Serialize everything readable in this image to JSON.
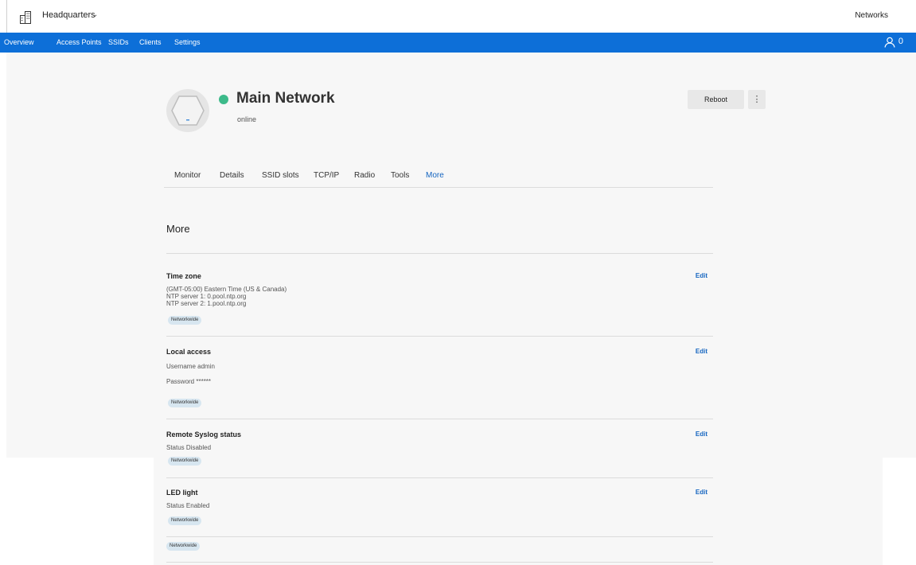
{
  "header": {
    "site_name": "Headquarters",
    "site_chevron": "⌄",
    "networks_label": "Networks",
    "building_icon": "building-icon"
  },
  "nav": {
    "items": [
      "Overview",
      "Access Points",
      "SSIDs",
      "Clients",
      "Settings"
    ],
    "user_count": "0",
    "color": "#0d6fd8"
  },
  "device": {
    "title": "Main Network",
    "status": "online",
    "status_color": "#3dba8a",
    "reboot_label": "Reboot",
    "kebab_label": "⋮"
  },
  "tabs": [
    "Monitor",
    "Details",
    "SSID slots",
    "TCP/IP",
    "Radio",
    "Tools",
    "More"
  ],
  "active_tab": "More",
  "section_title": "More",
  "cards": [
    {
      "title": "Time zone",
      "lines": [
        "(GMT-05:00) Eastern Time (US & Canada)",
        "NTP server 1: 0.pool.ntp.org",
        "NTP server 2: 1.pool.ntp.org"
      ],
      "badge": "Networkwide",
      "edit_label": "Edit"
    },
    {
      "title": "Local access",
      "lines": [
        "Username admin",
        "Password ******"
      ],
      "badge": "Networkwide",
      "edit_label": "Edit"
    },
    {
      "title": "Remote Syslog status",
      "lines": [
        "Status Disabled"
      ],
      "badge": "Networkwide",
      "edit_label": "Edit"
    },
    {
      "title": "LED light",
      "lines": [
        "Status Enabled"
      ],
      "badge": "Networkwide",
      "edit_label": "Edit"
    }
  ],
  "extra_badge": "Networkwide",
  "link_color": "#1565c0"
}
